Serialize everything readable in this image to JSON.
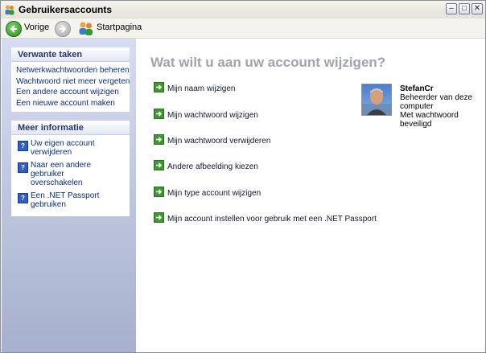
{
  "window": {
    "title": "Gebruikersaccounts"
  },
  "toolbar": {
    "back_label": "Vorige",
    "home_label": "Startpagina"
  },
  "sidebar": {
    "related_tasks": {
      "header": "Verwante taken",
      "items": [
        "Netwerkwachtwoorden beheren",
        "Wachtwoord niet meer vergeten",
        "Een andere account wijzigen",
        "Een nieuwe account maken"
      ]
    },
    "more_info": {
      "header": "Meer informatie",
      "items": [
        {
          "line1": "Uw eigen account",
          "line2": "verwijderen"
        },
        {
          "line1": "Naar een andere gebruiker",
          "line2": "overschakelen"
        },
        {
          "line1": "Een .NET Passport",
          "line2": "gebruiken"
        }
      ]
    }
  },
  "main": {
    "title": "Wat wilt u aan uw account wijzigen?",
    "actions": [
      "Mijn naam wijzigen",
      "Mijn wachtwoord wijzigen",
      "Mijn wachtwoord verwijderen",
      "Andere afbeelding kiezen",
      "Mijn type account wijzigen",
      "Mijn account instellen voor gebruik met een .NET Passport"
    ]
  },
  "user": {
    "name": "StefanCr",
    "role_line1": "Beheerder van deze",
    "role_line2": "computer",
    "status_line1": "Met wachtwoord",
    "status_line2": "beveiligd"
  },
  "icons": {
    "title": "users-icon",
    "back": "back-arrow-icon",
    "forward": "forward-arrow-icon",
    "home": "users-home-icon",
    "action": "green-arrow-icon",
    "help": "help-icon"
  }
}
